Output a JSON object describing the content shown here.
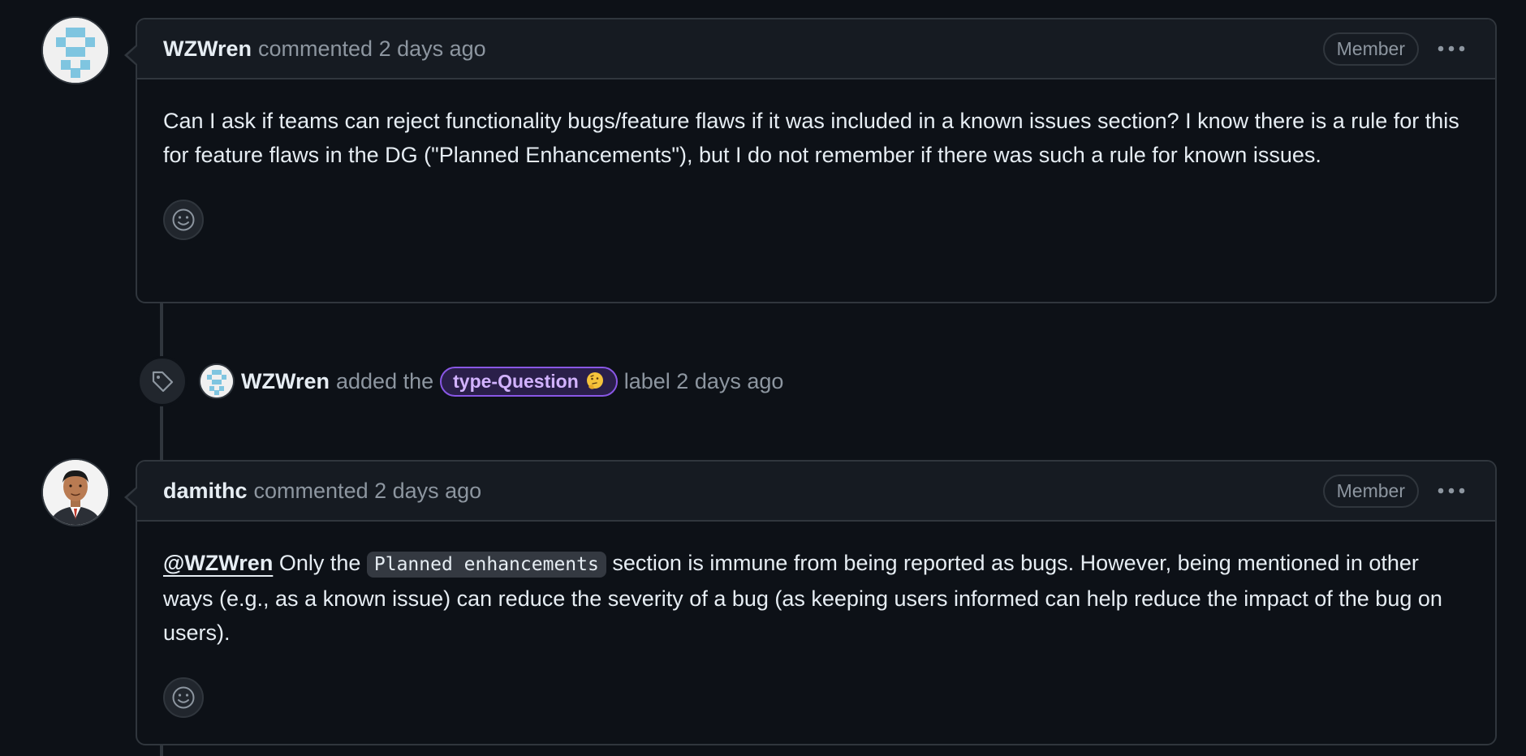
{
  "comments": [
    {
      "author": "WZWren",
      "meta": "commented 2 days ago",
      "badge": "Member",
      "body": "Can I ask if teams can reject functionality bugs/feature flaws if it was included in a known issues section? I know there is a rule for this for feature flaws in the DG (\"Planned Enhancements\"), but I do not remember if there was such a rule for known issues.",
      "avatar_icon": "identicon-avatar"
    },
    {
      "author": "damithc",
      "meta": "commented 2 days ago",
      "badge": "Member",
      "mention": "@WZWren",
      "body_part1": " Only the ",
      "code": "Planned enhancements",
      "body_part2": " section is immune from being reported as bugs. However, being mentioned in other ways (e.g., as a known issue) can reduce the severity of a bug (as keeping users informed can help reduce the impact of the bug on users).",
      "avatar_icon": "profile-photo-avatar"
    }
  ],
  "event": {
    "icon": "tag-icon",
    "actor": "WZWren",
    "text_before": "added the",
    "label": "type-Question",
    "label_emoji": "thinking-face-emoji",
    "text_after": "label 2 days ago"
  },
  "icons": {
    "kebab": "kebab-horizontal-icon",
    "reaction": "smiley-icon"
  },
  "colors": {
    "background": "#0d1117",
    "header_bg": "#161b22",
    "border": "#30363d",
    "muted_text": "#8d96a0",
    "label_border": "#8957e5",
    "label_text": "#d2b3ff",
    "identicon": "#7fc5e0"
  }
}
